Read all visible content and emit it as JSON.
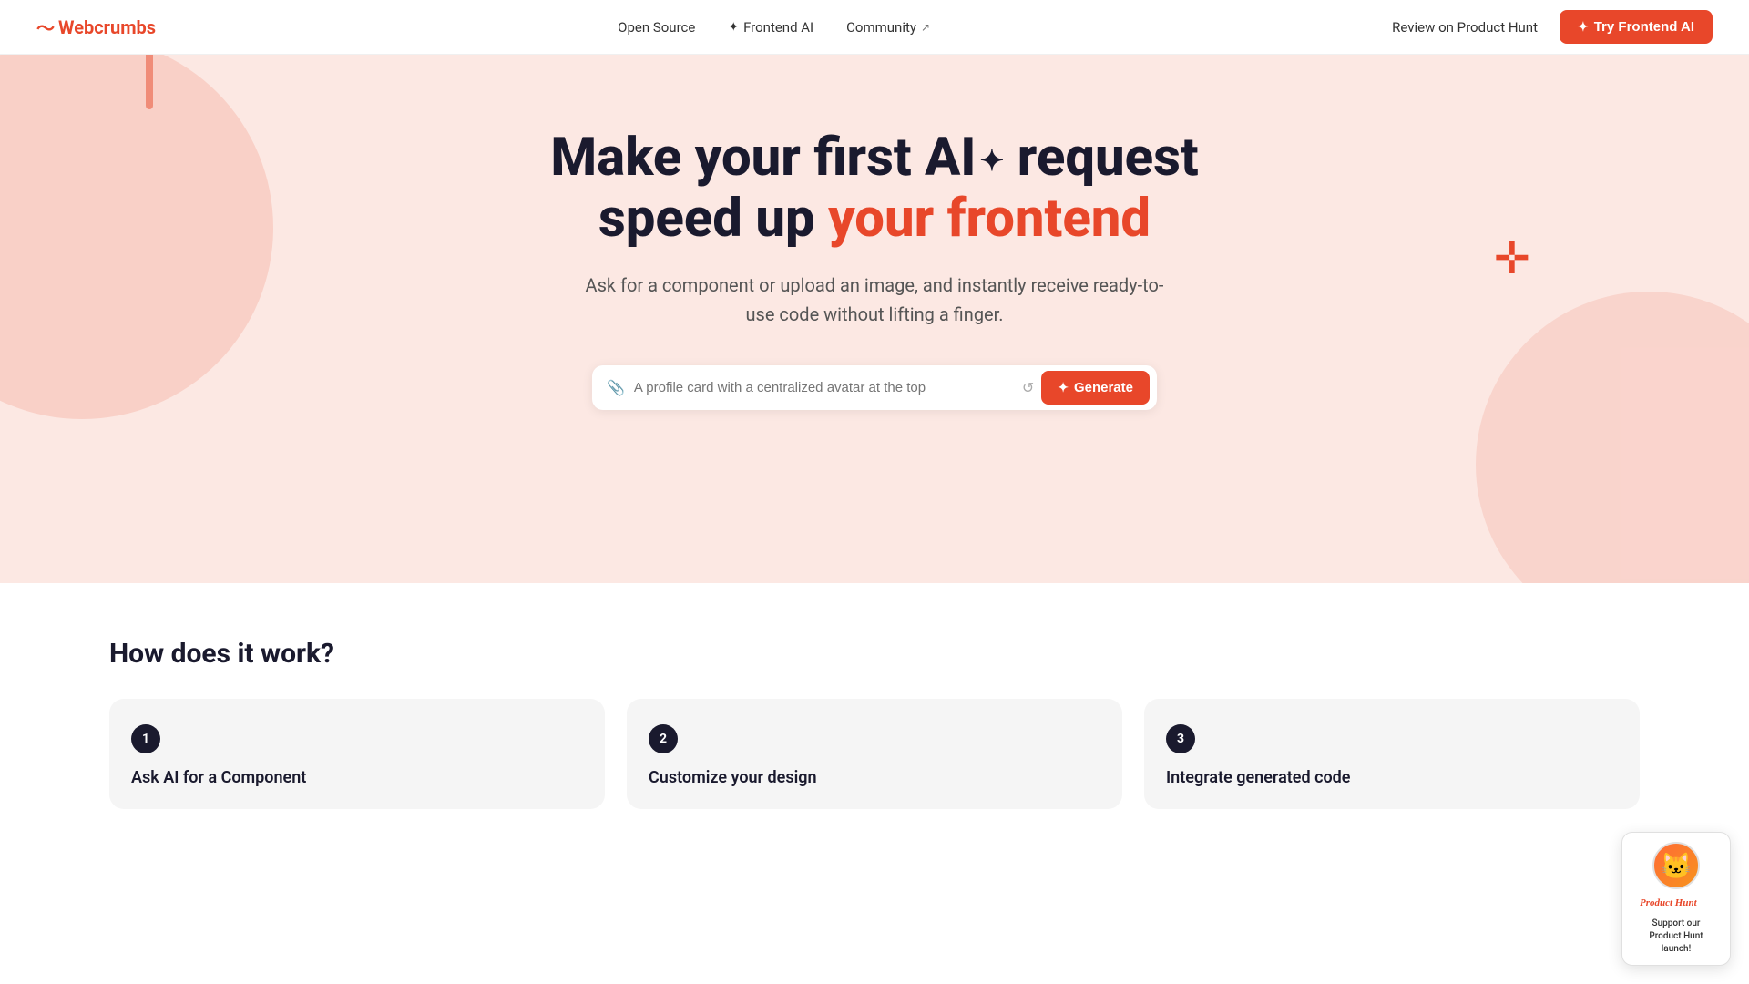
{
  "navbar": {
    "logo": "Webcrumbs",
    "nav_links": [
      {
        "id": "open-source",
        "label": "Open Source",
        "external": false
      },
      {
        "id": "frontend-ai",
        "label": "Frontend AI",
        "external": false,
        "has_icon": true
      },
      {
        "id": "community",
        "label": "Community",
        "external": true
      }
    ],
    "review_link": "Review on Product Hunt",
    "cta_label": "Try Frontend AI"
  },
  "hero": {
    "title_line1": "Make your first AI",
    "title_line1_suffix": " request",
    "title_line2_prefix": "speed up ",
    "title_line2_highlight": "your frontend",
    "subtitle": "Ask for a component or upload an image, and instantly receive ready-to-use code without lifting a finger.",
    "input_placeholder": "A profile card with a centralized avatar at the top",
    "generate_label": "Generate"
  },
  "how_section": {
    "title": "How does it work?",
    "cards": [
      {
        "number": "1",
        "label": "Ask AI for a Component"
      },
      {
        "number": "2",
        "label": "Customize your design"
      },
      {
        "number": "3",
        "label": "Integrate generated code"
      }
    ]
  },
  "ph_widget": {
    "support_text": "Support our Product Hunt launch!",
    "brand_text": "Product Hunt"
  }
}
